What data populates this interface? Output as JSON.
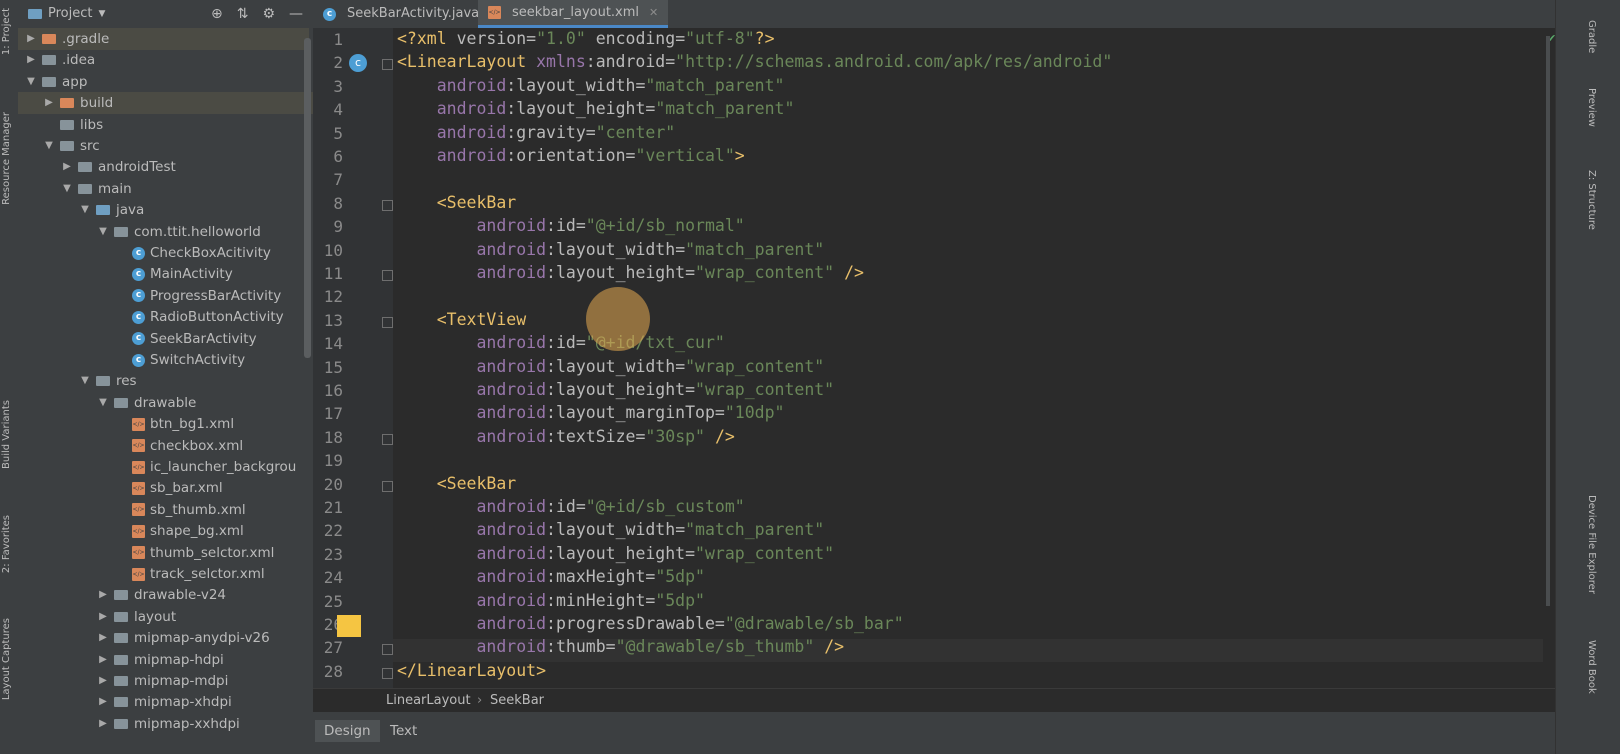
{
  "left_strip": {
    "tabs": [
      "1: Project",
      "Resource Manager",
      "Build Variants",
      "2: Favorites",
      "Layout Captures"
    ]
  },
  "project_panel": {
    "title": "Project",
    "tree": [
      {
        "label": ".gradle",
        "arrow": "▶",
        "icon": "folder-orange-icon",
        "indent": 1,
        "selected": true
      },
      {
        "label": ".idea",
        "arrow": "▶",
        "icon": "folder-icon",
        "indent": 1
      },
      {
        "label": "app",
        "arrow": "▼",
        "icon": "folder-icon",
        "indent": 1
      },
      {
        "label": "build",
        "arrow": "▶",
        "icon": "folder-orange-icon",
        "indent": 2,
        "selected": true
      },
      {
        "label": "libs",
        "arrow": "",
        "icon": "folder-icon",
        "indent": 2
      },
      {
        "label": "src",
        "arrow": "▼",
        "icon": "folder-icon",
        "indent": 2
      },
      {
        "label": "androidTest",
        "arrow": "▶",
        "icon": "folder-icon",
        "indent": 3
      },
      {
        "label": "main",
        "arrow": "▼",
        "icon": "folder-icon",
        "indent": 3
      },
      {
        "label": "java",
        "arrow": "▼",
        "icon": "folder-blue-icon",
        "indent": 4
      },
      {
        "label": "com.ttit.helloworld",
        "arrow": "▼",
        "icon": "package-icon",
        "indent": 5
      },
      {
        "label": "CheckBoxAcitivity",
        "arrow": "",
        "icon": "class-icon",
        "indent": 6
      },
      {
        "label": "MainActivity",
        "arrow": "",
        "icon": "class-icon",
        "indent": 6
      },
      {
        "label": "ProgressBarActivity",
        "arrow": "",
        "icon": "class-icon",
        "indent": 6
      },
      {
        "label": "RadioButtonActivity",
        "arrow": "",
        "icon": "class-icon",
        "indent": 6
      },
      {
        "label": "SeekBarActivity",
        "arrow": "",
        "icon": "class-icon",
        "indent": 6
      },
      {
        "label": "SwitchActivity",
        "arrow": "",
        "icon": "class-icon",
        "indent": 6
      },
      {
        "label": "res",
        "arrow": "▼",
        "icon": "folder-res-icon",
        "indent": 4
      },
      {
        "label": "drawable",
        "arrow": "▼",
        "icon": "folder-icon",
        "indent": 5
      },
      {
        "label": "btn_bg1.xml",
        "arrow": "",
        "icon": "xml-icon",
        "indent": 6
      },
      {
        "label": "checkbox.xml",
        "arrow": "",
        "icon": "xml-icon",
        "indent": 6
      },
      {
        "label": "ic_launcher_backgrou",
        "arrow": "",
        "icon": "xml-icon",
        "indent": 6
      },
      {
        "label": "sb_bar.xml",
        "arrow": "",
        "icon": "xml-icon",
        "indent": 6
      },
      {
        "label": "sb_thumb.xml",
        "arrow": "",
        "icon": "xml-icon",
        "indent": 6
      },
      {
        "label": "shape_bg.xml",
        "arrow": "",
        "icon": "xml-icon",
        "indent": 6
      },
      {
        "label": "thumb_selctor.xml",
        "arrow": "",
        "icon": "xml-icon",
        "indent": 6
      },
      {
        "label": "track_selctor.xml",
        "arrow": "",
        "icon": "xml-icon",
        "indent": 6
      },
      {
        "label": "drawable-v24",
        "arrow": "▶",
        "icon": "folder-icon",
        "indent": 5
      },
      {
        "label": "layout",
        "arrow": "▶",
        "icon": "folder-icon",
        "indent": 5
      },
      {
        "label": "mipmap-anydpi-v26",
        "arrow": "▶",
        "icon": "folder-icon",
        "indent": 5
      },
      {
        "label": "mipmap-hdpi",
        "arrow": "▶",
        "icon": "folder-icon",
        "indent": 5
      },
      {
        "label": "mipmap-mdpi",
        "arrow": "▶",
        "icon": "folder-icon",
        "indent": 5
      },
      {
        "label": "mipmap-xhdpi",
        "arrow": "▶",
        "icon": "folder-icon",
        "indent": 5
      },
      {
        "label": "mipmap-xxhdpi",
        "arrow": "▶",
        "icon": "folder-icon",
        "indent": 5
      }
    ]
  },
  "editor_tabs": [
    {
      "label": "SeekBarActivity.java",
      "icon": "class-icon",
      "active": false
    },
    {
      "label": "seekbar_layout.xml",
      "icon": "xml-icon",
      "active": true
    }
  ],
  "code": {
    "current_line": 26,
    "lines": [
      "<?xml version=\"1.0\" encoding=\"utf-8\"?>",
      "<LinearLayout xmlns:android=\"http://schemas.android.com/apk/res/android\"",
      "    android:layout_width=\"match_parent\"",
      "    android:layout_height=\"match_parent\"",
      "    android:gravity=\"center\"",
      "    android:orientation=\"vertical\">",
      "",
      "    <SeekBar",
      "        android:id=\"@+id/sb_normal\"",
      "        android:layout_width=\"match_parent\"",
      "        android:layout_height=\"wrap_content\" />",
      "",
      "    <TextView",
      "        android:id=\"@+id/txt_cur\"",
      "        android:layout_width=\"wrap_content\"",
      "        android:layout_height=\"wrap_content\"",
      "        android:layout_marginTop=\"10dp\"",
      "        android:textSize=\"30sp\" />",
      "",
      "    <SeekBar",
      "        android:id=\"@+id/sb_custom\"",
      "        android:layout_width=\"match_parent\"",
      "        android:layout_height=\"wrap_content\"",
      "        android:maxHeight=\"5dp\"",
      "        android:minHeight=\"5dp\"",
      "        android:progressDrawable=\"@drawable/sb_bar\"",
      "        android:thumb=\"@drawable/sb_thumb\" />",
      "</LinearLayout>"
    ]
  },
  "breadcrumb": [
    "LinearLayout",
    "SeekBar"
  ],
  "bottom_tabs": [
    {
      "label": "Design",
      "active": true
    },
    {
      "label": "Text",
      "active": false
    }
  ],
  "right_strip": {
    "tabs": [
      "Gradle",
      "Preview",
      "Z: Structure",
      "Device File Explorer",
      "Word Book"
    ]
  },
  "colors": {
    "tag": "#e8bf6a",
    "attr_ns": "#9876aa",
    "attr": "#bababa",
    "value": "#6a8759",
    "text": "#a9b7c6"
  }
}
